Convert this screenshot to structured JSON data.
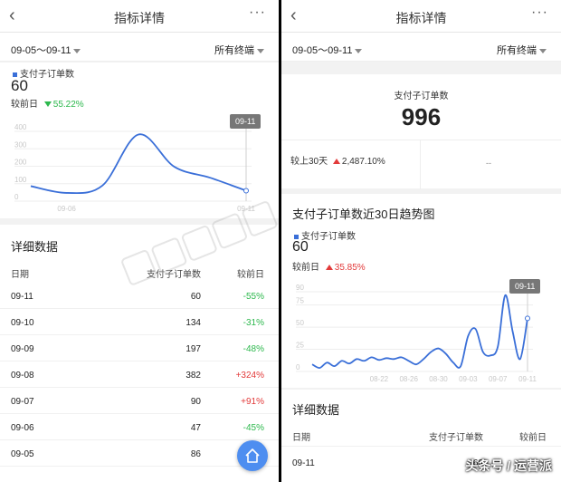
{
  "left": {
    "nav": {
      "back": "‹",
      "title": "指标详情",
      "more": "···"
    },
    "filter": {
      "date_range": "09-05～09-11",
      "terminal": "所有终端"
    },
    "metric": {
      "legend": "支付子订单数",
      "value": "60",
      "compare_label": "较前日",
      "compare_value": "55.22%"
    },
    "chart_data": {
      "type": "line",
      "x": [
        "09-05",
        "09-06",
        "09-07",
        "09-08",
        "09-09",
        "09-10",
        "09-11"
      ],
      "y": [
        86,
        47,
        90,
        382,
        197,
        134,
        60
      ],
      "yticks": [
        0,
        100,
        200,
        300,
        400
      ],
      "ylim": [
        0,
        400
      ],
      "xtick_labels": [
        "09-06",
        "09-11"
      ],
      "tooltip": "09-11",
      "color": "#3a6fd8"
    },
    "detail": {
      "title": "详细数据",
      "headers": [
        "日期",
        "支付子订单数",
        "较前日"
      ],
      "rows": [
        {
          "date": "09-11",
          "count": "60",
          "change": "-55%",
          "dir": "down"
        },
        {
          "date": "09-10",
          "count": "134",
          "change": "-31%",
          "dir": "down"
        },
        {
          "date": "09-09",
          "count": "197",
          "change": "-48%",
          "dir": "down"
        },
        {
          "date": "09-08",
          "count": "382",
          "change": "+324%",
          "dir": "up"
        },
        {
          "date": "09-07",
          "count": "90",
          "change": "+91%",
          "dir": "up"
        },
        {
          "date": "09-06",
          "count": "47",
          "change": "-45%",
          "dir": "down"
        },
        {
          "date": "09-05",
          "count": "86",
          "change": "",
          "dir": "none"
        }
      ]
    },
    "home_icon": "home-icon"
  },
  "right": {
    "nav": {
      "back": "‹",
      "title": "指标详情",
      "more": "···"
    },
    "filter": {
      "date_range": "09-05～09-11",
      "terminal": "所有终端"
    },
    "summary": {
      "label": "支付子订单数",
      "value": "996",
      "compare_label": "较上30天",
      "compare_value": "2,487.10%",
      "right_placeholder": "--"
    },
    "trend": {
      "title": "支付子订单数近30日趋势图",
      "legend": "支付子订单数",
      "value": "60",
      "compare_label": "较前日",
      "compare_value": "35.85%"
    },
    "chart_data": {
      "type": "line",
      "x": [
        "08-13",
        "08-14",
        "08-15",
        "08-16",
        "08-17",
        "08-18",
        "08-19",
        "08-20",
        "08-21",
        "08-22",
        "08-23",
        "08-24",
        "08-25",
        "08-26",
        "08-27",
        "08-28",
        "08-29",
        "08-30",
        "08-31",
        "09-01",
        "09-02",
        "09-03",
        "09-04",
        "09-05",
        "09-06",
        "09-07",
        "09-08",
        "09-09",
        "09-10",
        "09-11"
      ],
      "y": [
        8,
        4,
        10,
        6,
        12,
        9,
        14,
        12,
        16,
        13,
        15,
        14,
        16,
        12,
        8,
        14,
        22,
        26,
        20,
        10,
        6,
        40,
        48,
        22,
        18,
        28,
        86,
        45,
        14,
        60
      ],
      "yticks": [
        0,
        25,
        50,
        75,
        90
      ],
      "ylim": [
        0,
        90
      ],
      "xtick_labels": [
        "08-22",
        "08-26",
        "08-30",
        "09-03",
        "09-07",
        "09-11"
      ],
      "tooltip": "09-11",
      "color": "#3a6fd8"
    },
    "detail": {
      "title": "详细数据",
      "headers": [
        "日期",
        "支付子订单数",
        "较前日"
      ],
      "rows": [
        {
          "date": "09-11",
          "count": "60",
          "change": ""
        }
      ]
    },
    "watermark": "头条号 / 运营派"
  }
}
